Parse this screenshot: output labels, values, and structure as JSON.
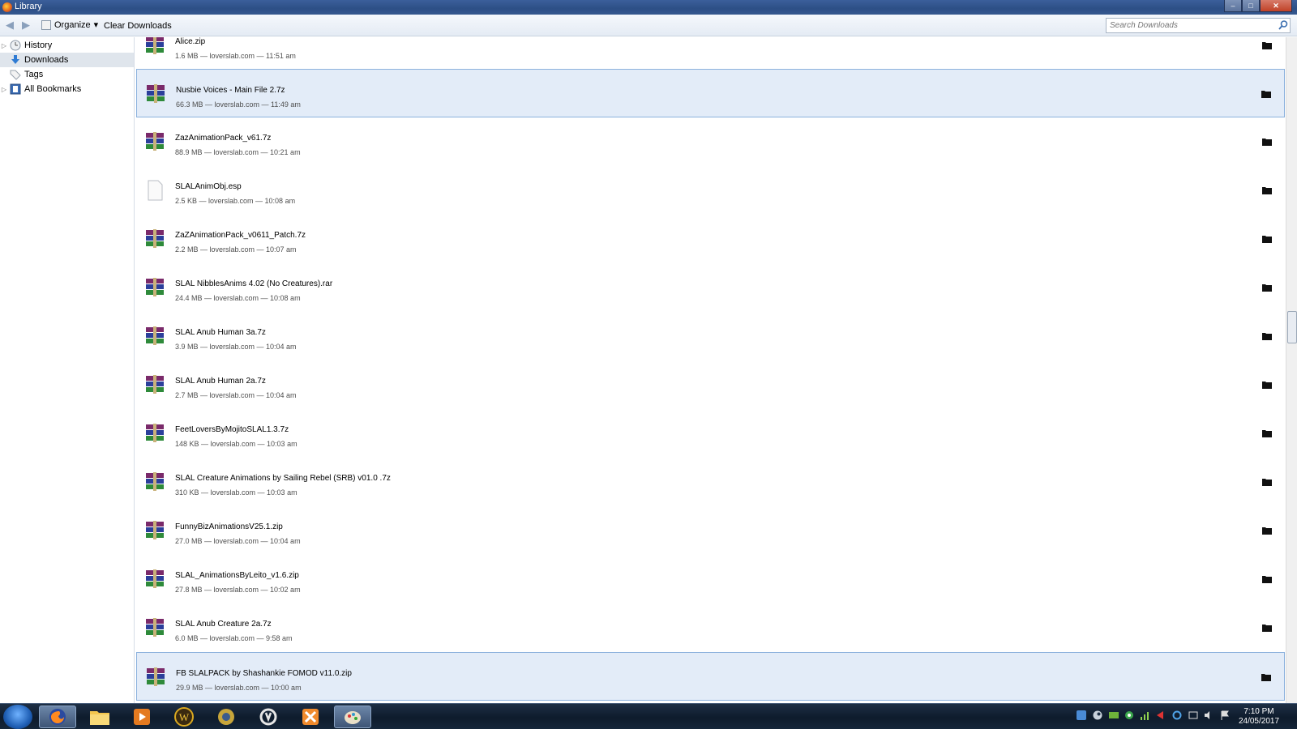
{
  "window": {
    "title": "Library",
    "controls": {
      "minimize": "–",
      "maximize": "□",
      "close": "✕"
    }
  },
  "toolbar": {
    "back": "◀",
    "forward": "▶",
    "organize_label": "Organize",
    "organize_arrow": "▾",
    "clear_label": "Clear Downloads",
    "search_placeholder": "Search Downloads"
  },
  "sidebar": {
    "items": [
      {
        "label": "History",
        "icon": "clock-icon",
        "expandable": true,
        "selected": false
      },
      {
        "label": "Downloads",
        "icon": "download-arrow-icon",
        "expandable": false,
        "selected": true
      },
      {
        "label": "Tags",
        "icon": "tag-icon",
        "expandable": false,
        "selected": false
      },
      {
        "label": "All Bookmarks",
        "icon": "bookmarks-icon",
        "expandable": true,
        "selected": false
      }
    ]
  },
  "downloads": [
    {
      "name": "Alice.zip",
      "meta": "1.6 MB — loverslab.com — 11:51 am",
      "icon": "archive-icon",
      "selected": false
    },
    {
      "name": "Nusbie Voices - Main File 2.7z",
      "meta": "66.3 MB — loverslab.com — 11:49 am",
      "icon": "archive-icon",
      "selected": true
    },
    {
      "name": "ZazAnimationPack_v61.7z",
      "meta": "88.9 MB — loverslab.com — 10:21 am",
      "icon": "archive-icon",
      "selected": false
    },
    {
      "name": "SLALAnimObj.esp",
      "meta": "2.5 KB — loverslab.com — 10:08 am",
      "icon": "blank-file-icon",
      "selected": false
    },
    {
      "name": "ZaZAnimationPack_v0611_Patch.7z",
      "meta": "2.2 MB — loverslab.com — 10:07 am",
      "icon": "archive-icon",
      "selected": false
    },
    {
      "name": "SLAL NibblesAnims 4.02 (No Creatures).rar",
      "meta": "24.4 MB — loverslab.com — 10:08 am",
      "icon": "archive-icon",
      "selected": false
    },
    {
      "name": "SLAL Anub Human 3a.7z",
      "meta": "3.9 MB — loverslab.com — 10:04 am",
      "icon": "archive-icon",
      "selected": false
    },
    {
      "name": "SLAL Anub Human 2a.7z",
      "meta": "2.7 MB — loverslab.com — 10:04 am",
      "icon": "archive-icon",
      "selected": false
    },
    {
      "name": "FeetLoversByMojitoSLAL1.3.7z",
      "meta": "148 KB — loverslab.com — 10:03 am",
      "icon": "archive-icon",
      "selected": false
    },
    {
      "name": "SLAL Creature Animations by Sailing Rebel (SRB) v01.0 .7z",
      "meta": "310 KB — loverslab.com — 10:03 am",
      "icon": "archive-icon",
      "selected": false
    },
    {
      "name": "FunnyBizAnimationsV25.1.zip",
      "meta": "27.0 MB — loverslab.com — 10:04 am",
      "icon": "archive-icon",
      "selected": false
    },
    {
      "name": "SLAL_AnimationsByLeito_v1.6.zip",
      "meta": "27.8 MB — loverslab.com — 10:02 am",
      "icon": "archive-icon",
      "selected": false
    },
    {
      "name": "SLAL Anub Creature 2a.7z",
      "meta": "6.0 MB — loverslab.com — 9:58 am",
      "icon": "archive-icon",
      "selected": false
    },
    {
      "name": "FB SLALPACK by Shashankie FOMOD v11.0.zip",
      "meta": "29.9 MB — loverslab.com — 10:00 am",
      "icon": "archive-icon",
      "selected": true
    }
  ],
  "taskbar": {
    "apps": [
      "firefox-icon",
      "file-explorer-icon",
      "media-player-icon",
      "world-of-warcraft-icon",
      "settings-gear-app-icon",
      "overwatch-icon",
      "game-app-icon",
      "paint-icon"
    ],
    "active_app": "paint-icon",
    "clock_time": "7:10 PM",
    "clock_date": "24/05/2017"
  },
  "colors": {
    "selection_fill": "#e3ecf8",
    "selection_border": "#8bb1dd",
    "titlebar": "#2d4f86",
    "taskbar": "#0e1b2c"
  }
}
